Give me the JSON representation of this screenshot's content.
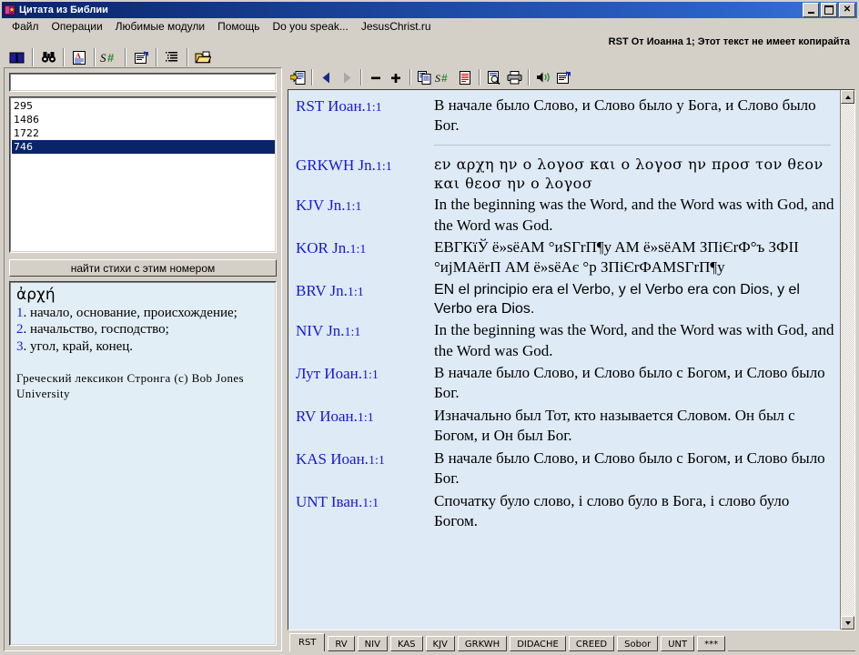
{
  "window": {
    "title": "Цитата из Библии",
    "icon": "bible-book-icon",
    "buttons": {
      "minimize": "_",
      "maximize": "□",
      "close": "✕"
    }
  },
  "menu": {
    "items": [
      {
        "label": "Файл",
        "name": "menu-file"
      },
      {
        "label": "Операции",
        "name": "menu-operations"
      },
      {
        "label": "Любимые модули",
        "name": "menu-favorite-modules"
      },
      {
        "label": "Помощь",
        "name": "menu-help"
      },
      {
        "label": "Do you speak...",
        "name": "menu-do-you-speak"
      },
      {
        "label": "JesusChrist.ru",
        "name": "menu-jesuschrist-ru"
      }
    ]
  },
  "status": {
    "caption": "RST От Иоанна 1; Этот текст не имеет копирайта"
  },
  "left_toolbar": {
    "buttons": [
      {
        "icon": "open-book-icon",
        "name": "toolbar-book-button"
      },
      {
        "icon": "binoculars-search-icon",
        "name": "toolbar-search-button"
      },
      {
        "icon": "document-letter-a-icon",
        "name": "toolbar-text-button"
      },
      {
        "icon": "strongs-number-icon",
        "name": "toolbar-strongs-button",
        "label": "S#"
      },
      {
        "icon": "notes-pencil-icon",
        "name": "toolbar-notes-button"
      },
      {
        "icon": "list-outline-icon",
        "name": "toolbar-list-button"
      },
      {
        "icon": "open-folder-icon",
        "name": "toolbar-open-folder-button"
      }
    ]
  },
  "right_toolbar": {
    "buttons": [
      {
        "icon": "window-new-icon",
        "name": "rtoolbar-new-window-button"
      },
      {
        "icon": "arrow-left-icon",
        "name": "rtoolbar-back-button"
      },
      {
        "icon": "arrow-right-icon",
        "name": "rtoolbar-forward-button"
      },
      {
        "icon": "minus-icon",
        "name": "rtoolbar-zoom-out-button"
      },
      {
        "icon": "plus-icon",
        "name": "rtoolbar-zoom-in-button"
      },
      {
        "icon": "copy-icon",
        "name": "rtoolbar-copy-button"
      },
      {
        "icon": "strongs-number-icon",
        "name": "rtoolbar-strongs-button",
        "label": "S#"
      },
      {
        "icon": "document-lines-icon",
        "name": "rtoolbar-document-button"
      },
      {
        "icon": "print-preview-icon",
        "name": "rtoolbar-print-preview-button"
      },
      {
        "icon": "printer-icon",
        "name": "rtoolbar-print-button"
      },
      {
        "icon": "speaker-icon",
        "name": "rtoolbar-sound-button"
      },
      {
        "icon": "properties-icon",
        "name": "rtoolbar-properties-button"
      }
    ]
  },
  "left_panel": {
    "number_input": {
      "value": "",
      "placeholder": ""
    },
    "number_list": [
      {
        "value": "295",
        "selected": false
      },
      {
        "value": "1486",
        "selected": false
      },
      {
        "value": "1722",
        "selected": false
      },
      {
        "value": "746",
        "selected": true
      }
    ],
    "find_button_label": "найти стихи с этим номером",
    "lexicon": {
      "headword": "ἀρχή",
      "definitions": [
        {
          "num": "1",
          "text": ". начало, основание, происхождение;"
        },
        {
          "num": "2",
          "text": ". начальство, господство;"
        },
        {
          "num": "3",
          "text": ". угол, край, конец."
        }
      ],
      "source": "Греческий лексикон Стронга (c) Bob Jones University"
    }
  },
  "verses": [
    {
      "ref_book": "RST Иоан.",
      "ref_cv": "1:1",
      "text": "В начале было Слово, и Слово было у Бога, и Слово было Бог.",
      "style": "serif",
      "divider_after": true
    },
    {
      "ref_book": "GRKWH Jn.",
      "ref_cv": "1:1",
      "text": "εν αρχη ην ο λογοσ και ο λογοσ ην προσ τον θεον και θεοσ ην ο λογοσ",
      "style": "greek",
      "divider_after": false
    },
    {
      "ref_book": "KJV Jn.",
      "ref_cv": "1:1",
      "text": "In the beginning was the Word, and the Word was with God, and the Word was God.",
      "style": "serif",
      "divider_after": false
    },
    {
      "ref_book": "KOR Jn.",
      "ref_cv": "1:1",
      "text": "ЕВГКïЎ ё»sёAM °иSГrП¶y AM ё»sёAM ЗПiЄrФ°ъ ЗФII °иjMAёrП AM ё»sёAє °p ЗПiЄrФAMSГrП¶y",
      "style": "serif",
      "divider_after": false
    },
    {
      "ref_book": "BRV Jn.",
      "ref_cv": "1:1",
      "text": "EN el principio era el Verbo, y el Verbo era con Dios, y el Verbo era Dios.",
      "style": "sans",
      "divider_after": false
    },
    {
      "ref_book": "NIV Jn.",
      "ref_cv": "1:1",
      "text": "In the beginning was the Word, and the Word was with God, and the Word was God.",
      "style": "serif",
      "divider_after": false
    },
    {
      "ref_book": "Лут Иоан.",
      "ref_cv": "1:1",
      "text": "В начале было Слово, и Слово было с Богом, и Слово было Бог.",
      "style": "serif",
      "divider_after": false
    },
    {
      "ref_book": "RV Иоан.",
      "ref_cv": "1:1",
      "text": "Изначально был Тот, кто называется Словом. Он был с Богом, и Он был Бог.",
      "style": "serif",
      "divider_after": false
    },
    {
      "ref_book": "KAS Иоан.",
      "ref_cv": "1:1",
      "text": "В начале было Слово, и Слово было с Богом, и Слово было Бог.",
      "style": "serif",
      "divider_after": false
    },
    {
      "ref_book": "UNT Іван.",
      "ref_cv": "1:1",
      "text": "Спочатку було слово, і слово було в Бога, і слово було Богом.",
      "style": "serif",
      "divider_after": false
    }
  ],
  "tabs": [
    {
      "label": "RST",
      "active": true
    },
    {
      "label": "RV",
      "active": false
    },
    {
      "label": "NIV",
      "active": false
    },
    {
      "label": "KAS",
      "active": false
    },
    {
      "label": "KJV",
      "active": false
    },
    {
      "label": "GRKWH",
      "active": false
    },
    {
      "label": "DIDACHE",
      "active": false
    },
    {
      "label": "CREED",
      "active": false
    },
    {
      "label": "Sobor",
      "active": false
    },
    {
      "label": "UNT",
      "active": false
    },
    {
      "label": "***",
      "active": false
    }
  ],
  "colors": {
    "titlebar_start": "#0a246a",
    "titlebar_end": "#3a74d8",
    "window_face": "#d4d0c8",
    "verse_background": "#deeaf6",
    "lexicon_background": "#e2eef6",
    "reference_blue": "#1818d8",
    "selection_blue": "#0a246a"
  }
}
